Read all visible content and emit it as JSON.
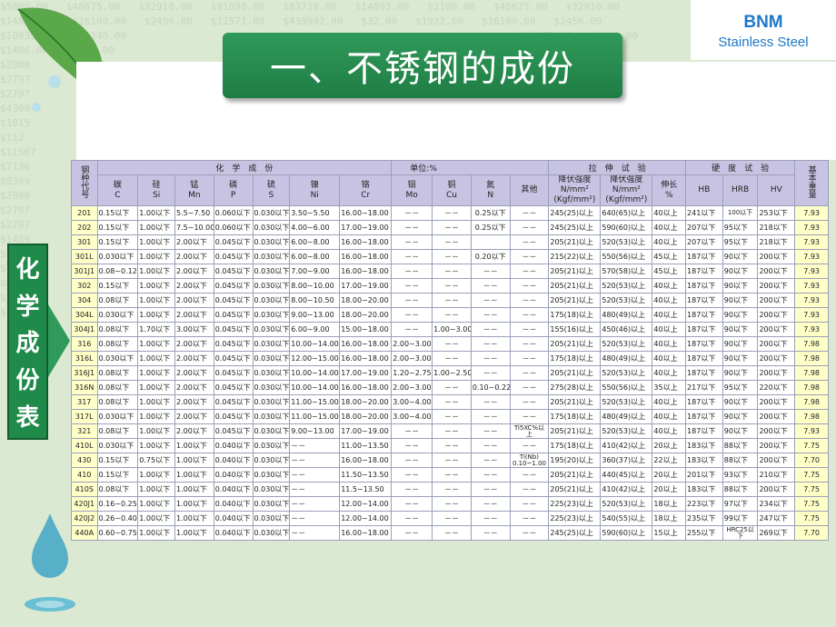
{
  "brand": {
    "line1": "BNM",
    "line2": "Stainless Steel"
  },
  "title": "一、不锈钢的成份",
  "side_label": [
    "化",
    "学",
    "成",
    "份",
    "表"
  ],
  "bg_lines": [
    "$5800.00   $48675.00   $32910.00   $91890.00   $83729.00   $14893.00   $2100.00   $48675.00   $32910.00",
    "$14893.00   $16100.00   $2456.00   $11571.00   $430992.00   $32.00   $1932.00   $16100.00   $2456.00",
    "$10835.00   $80140.00                                                                  $9837.00   $9345.00",
    "$1406.00   $6350.00                                                           $385119.00   $8472.00",
    "$2800",
    "$2797",
    "$2797",
    "$4309",
    "$1915",
    "$112",
    "$11567",
    "$7136",
    "$8399",
    "$2800",
    "$2797",
    "$2797",
    "$1489",
    "$1489",
    "$7136",
    "$8399",
    "$2800",
    "$1489"
  ],
  "table": {
    "group_headers": {
      "grade": "钢种代号",
      "chem": "化　学　成　份",
      "unit": "单位:%",
      "tensile": "拉　伸　试　验",
      "hardness": "硬　度　试　验",
      "weight": "基本重量"
    },
    "col_headers": [
      [
        "碳",
        "C"
      ],
      [
        "硅",
        "Si"
      ],
      [
        "锰",
        "Mn"
      ],
      [
        "磷",
        "P"
      ],
      [
        "硫",
        "S"
      ],
      [
        "镍",
        "Ni"
      ],
      [
        "铬",
        "Cr"
      ],
      [
        "钼",
        "Mo"
      ],
      [
        "铜",
        "Cu"
      ],
      [
        "氮",
        "N"
      ],
      [
        "其他",
        ""
      ],
      [
        "降伏强度",
        "N/mm²",
        "(Kgf/mm²)"
      ],
      [
        "降伏强度",
        "N/mm²",
        "(Kgf/mm²)"
      ],
      [
        "伸长",
        "%"
      ],
      [
        "HB",
        ""
      ],
      [
        "HRB",
        ""
      ],
      [
        "HV",
        ""
      ]
    ],
    "rows": [
      [
        "201",
        "0.15以下",
        "1.00以下",
        "5.5~7.50",
        "0.060以下",
        "0.030以下",
        "3.50~5.50",
        "16.00~18.00",
        "－－",
        "－－",
        "0.25以下",
        "－－",
        "245(25)以上",
        "640(65)以上",
        "40以上",
        "241以下",
        "100以下",
        "253以下",
        "7.93"
      ],
      [
        "202",
        "0.15以下",
        "1.00以下",
        "7.5~10.00",
        "0.060以下",
        "0.030以下",
        "4.00~6.00",
        "17.00~19.00",
        "－－",
        "－－",
        "0.25以下",
        "－－",
        "245(25)以上",
        "590(60)以上",
        "40以上",
        "207以下",
        "95以下",
        "218以下",
        "7.93"
      ],
      [
        "301",
        "0.15以下",
        "1.00以下",
        "2.00以下",
        "0.045以下",
        "0.030以下",
        "6.00~8.00",
        "16.00~18.00",
        "－－",
        "－－",
        "",
        "－－",
        "205(21)以上",
        "520(53)以上",
        "40以上",
        "207以下",
        "95以下",
        "218以下",
        "7.93"
      ],
      [
        "301L",
        "0.030以下",
        "1.00以下",
        "2.00以下",
        "0.045以下",
        "0.030以下",
        "6.00~8.00",
        "16.00~18.00",
        "－－",
        "－－",
        "0.20以下",
        "－－",
        "215(22)以上",
        "550(56)以上",
        "45以上",
        "187以下",
        "90以下",
        "200以下",
        "7.93"
      ],
      [
        "301J1",
        "0.08~0.12",
        "1.00以下",
        "2.00以下",
        "0.045以下",
        "0.030以下",
        "7.00~9.00",
        "16.00~18.00",
        "－－",
        "－－",
        "－－",
        "－－",
        "205(21)以上",
        "570(58)以上",
        "45以上",
        "187以下",
        "90以下",
        "200以下",
        "7.93"
      ],
      [
        "302",
        "0.15以下",
        "1.00以下",
        "2.00以下",
        "0.045以下",
        "0.030以下",
        "8.00~10.00",
        "17.00~19.00",
        "－－",
        "－－",
        "－－",
        "－－",
        "205(21)以上",
        "520(53)以上",
        "40以上",
        "187以下",
        "90以下",
        "200以下",
        "7.93"
      ],
      [
        "304",
        "0.08以下",
        "1.00以下",
        "2.00以下",
        "0.045以下",
        "0.030以下",
        "8.00~10.50",
        "18.00~20.00",
        "－－",
        "－－",
        "－－",
        "－－",
        "205(21)以上",
        "520(53)以上",
        "40以上",
        "187以下",
        "90以下",
        "200以下",
        "7.93"
      ],
      [
        "304L",
        "0.030以下",
        "1.00以下",
        "2.00以下",
        "0.045以下",
        "0.030以下",
        "9.00~13.00",
        "18.00~20.00",
        "－－",
        "－－",
        "－－",
        "－－",
        "175(18)以上",
        "480(49)以上",
        "40以上",
        "187以下",
        "90以下",
        "200以下",
        "7.93"
      ],
      [
        "304J1",
        "0.08以下",
        "1.70以下",
        "3.00以下",
        "0.045以下",
        "0.030以下",
        "6.00~9.00",
        "15.00~18.00",
        "－－",
        "1.00~3.00",
        "－－",
        "－－",
        "155(16)以上",
        "450(46)以上",
        "40以上",
        "187以下",
        "90以下",
        "200以下",
        "7.93"
      ],
      [
        "316",
        "0.08以下",
        "1.00以下",
        "2.00以下",
        "0.045以下",
        "0.030以下",
        "10.00~14.00",
        "16.00~18.00",
        "2.00~3.00",
        "－－",
        "－－",
        "－－",
        "205(21)以上",
        "520(53)以上",
        "40以上",
        "187以下",
        "90以下",
        "200以下",
        "7.98"
      ],
      [
        "316L",
        "0.030以下",
        "1.00以下",
        "2.00以下",
        "0.045以下",
        "0.030以下",
        "12.00~15.00",
        "16.00~18.00",
        "2.00~3.00",
        "－－",
        "－－",
        "－－",
        "175(18)以上",
        "480(49)以上",
        "40以上",
        "187以下",
        "90以下",
        "200以下",
        "7.98"
      ],
      [
        "316J1",
        "0.08以下",
        "1.00以下",
        "2.00以下",
        "0.045以下",
        "0.030以下",
        "10.00~14.00",
        "17.00~19.00",
        "1.20~2.75",
        "1.00~2.50",
        "－－",
        "－－",
        "205(21)以上",
        "520(53)以上",
        "40以上",
        "187以下",
        "90以下",
        "200以下",
        "7.98"
      ],
      [
        "316N",
        "0.08以下",
        "1.00以下",
        "2.00以下",
        "0.045以下",
        "0.030以下",
        "10.00~14.00",
        "16.00~18.00",
        "2.00~3.00",
        "－－",
        "0.10~0.22",
        "－－",
        "275(28)以上",
        "550(56)以上",
        "35以上",
        "217以下",
        "95以下",
        "220以下",
        "7.98"
      ],
      [
        "317",
        "0.08以下",
        "1.00以下",
        "2.00以下",
        "0.045以下",
        "0.030以下",
        "11.00~15.00",
        "18.00~20.00",
        "3.00~4.00",
        "－－",
        "－－",
        "－－",
        "205(21)以上",
        "520(53)以上",
        "40以上",
        "187以下",
        "90以下",
        "200以下",
        "7.98"
      ],
      [
        "317L",
        "0.030以下",
        "1.00以下",
        "2.00以下",
        "0.045以下",
        "0.030以下",
        "11.00~15.00",
        "18.00~20.00",
        "3.00~4.00",
        "－－",
        "－－",
        "－－",
        "175(18)以上",
        "480(49)以上",
        "40以上",
        "187以下",
        "90以下",
        "200以下",
        "7.98"
      ],
      [
        "321",
        "0.08以下",
        "1.00以下",
        "2.00以下",
        "0.045以下",
        "0.030以下",
        "9.00~13.00",
        "17.00~19.00",
        "－－",
        "－－",
        "－－",
        "Ti5XC%以上",
        "205(21)以上",
        "520(53)以上",
        "40以上",
        "187以下",
        "90以下",
        "200以下",
        "7.93"
      ],
      [
        "410L",
        "0.030以下",
        "1.00以下",
        "1.00以下",
        "0.040以下",
        "0.030以下",
        "－－",
        "11.00~13.50",
        "－－",
        "－－",
        "－－",
        "－－",
        "175(18)以上",
        "410(42)以上",
        "20以上",
        "183以下",
        "88以下",
        "200以下",
        "7.75"
      ],
      [
        "430",
        "0.15以下",
        "0.75以下",
        "1.00以下",
        "0.040以下",
        "0.030以下",
        "－－",
        "16.00~18.00",
        "－－",
        "－－",
        "－－",
        "Ti(Nb) 0.10~1.00",
        "195(20)以上",
        "360(37)以上",
        "22以上",
        "183以下",
        "88以下",
        "200以下",
        "7.70"
      ],
      [
        "410",
        "0.15以下",
        "1.00以下",
        "1.00以下",
        "0.040以下",
        "0.030以下",
        "－－",
        "11.50~13.50",
        "－－",
        "－－",
        "－－",
        "－－",
        "205(21)以上",
        "440(45)以上",
        "20以上",
        "201以下",
        "93以下",
        "210以下",
        "7.75"
      ],
      [
        "410S",
        "0.08以下",
        "1.00以下",
        "1.00以下",
        "0.040以下",
        "0.030以下",
        "－－",
        "11.5~13.50",
        "－－",
        "－－",
        "－－",
        "－－",
        "205(21)以上",
        "410(42)以上",
        "20以上",
        "183以下",
        "88以下",
        "200以下",
        "7.75"
      ],
      [
        "420J1",
        "0.16~0.25",
        "1.00以下",
        "1.00以下",
        "0.040以下",
        "0.030以下",
        "－－",
        "12.00~14.00",
        "－－",
        "－－",
        "－－",
        "－－",
        "225(23)以上",
        "520(53)以上",
        "18以上",
        "223以下",
        "97以下",
        "234以下",
        "7.75"
      ],
      [
        "420J2",
        "0.26~0.40",
        "1.00以下",
        "1.00以下",
        "0.040以下",
        "0.030以下",
        "－－",
        "12.00~14.00",
        "－－",
        "－－",
        "－－",
        "－－",
        "225(23)以上",
        "540(55)以上",
        "18以上",
        "235以下",
        "99以下",
        "247以下",
        "7.75"
      ],
      [
        "440A",
        "0.60~0.75",
        "1.00以下",
        "1.00以下",
        "0.040以下",
        "0.030以下",
        "－－",
        "16.00~18.00",
        "－－",
        "－－",
        "－－",
        "－－",
        "245(25)以上",
        "590(60)以上",
        "15以上",
        "255以下",
        "HRC25以下",
        "269以下",
        "7.70"
      ]
    ]
  }
}
